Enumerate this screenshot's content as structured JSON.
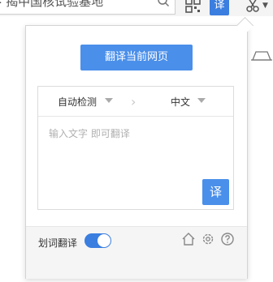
{
  "browser": {
    "address_text": "· 揭中国核试验基地",
    "extension_label": "译"
  },
  "popup": {
    "translate_page_label": "翻译当前网页",
    "source_language": "自动检测",
    "target_language": "中文",
    "input_placeholder": "输入文字 即可翻译",
    "translate_button_label": "译",
    "word_translate_label": "划词翻译",
    "word_translate_enabled": true
  },
  "colors": {
    "accent": "#4a8fea",
    "toggle_on": "#3a7ee0"
  },
  "icons": [
    "search-icon",
    "qr-icon",
    "scissors-icon",
    "home-icon",
    "gear-icon",
    "help-icon"
  ]
}
